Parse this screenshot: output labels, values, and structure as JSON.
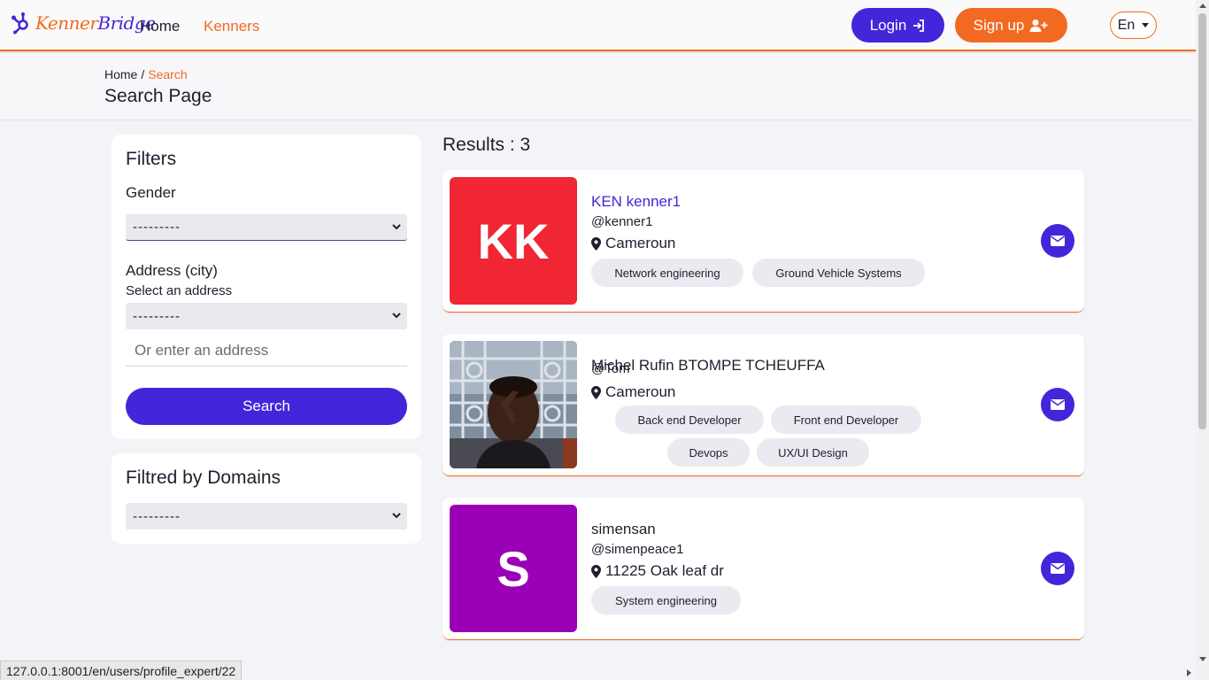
{
  "nav": {
    "brand_part1": "Kenner",
    "brand_part2": "Bridge",
    "home": "Home",
    "kenners": "Kenners",
    "login": "Login",
    "signup": "Sign up",
    "lang": "En"
  },
  "header": {
    "breadcrumb_home": "Home",
    "breadcrumb_sep": "/",
    "breadcrumb_current": "Search",
    "title": "Search Page"
  },
  "filters": {
    "title": "Filters",
    "gender_label": "Gender",
    "gender_value": "---------",
    "address_label": "Address (city)",
    "address_sub": "Select an address",
    "address_value": "---------",
    "address_placeholder": "Or enter an address",
    "search_button": "Search"
  },
  "domains": {
    "title": "Filtred by Domains",
    "value": "---------"
  },
  "results": {
    "title": "Results : 3",
    "items": [
      {
        "initials": "KK",
        "name": "KEN kenner1",
        "handle": "@kenner1",
        "location": "Cameroun",
        "tags": [
          "Network engineering",
          "Ground Vehicle Systems"
        ],
        "color": "#f02634"
      },
      {
        "initials": "",
        "name": "Michel Rufin BTOMPE TCHEUFFA",
        "handle": "@Tom",
        "location": "Cameroun",
        "tags": [
          "Back end Developer",
          "Front end Developer",
          "Devops",
          "UX/UI Design"
        ],
        "color": "#2a2f36"
      },
      {
        "initials": "S",
        "name": "simensan",
        "handle": "@simenpeace1",
        "location": "11225 Oak leaf dr",
        "tags": [
          "System engineering"
        ],
        "color": "#9a00b5"
      }
    ]
  },
  "status_url": "127.0.0.1:8001/en/users/profile_expert/22",
  "colors": {
    "primary": "#4326d9",
    "accent": "#f26a21"
  }
}
